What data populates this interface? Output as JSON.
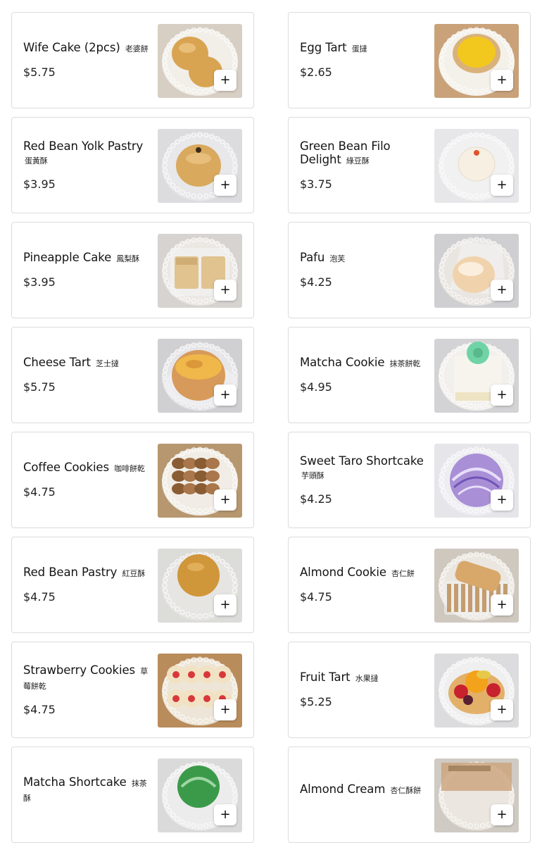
{
  "menu": {
    "add_symbol": "+",
    "items": [
      {
        "name": "Wife Cake (2pcs)",
        "zh": "老婆餅",
        "price": "$5.75",
        "icon": "wife-cake-photo",
        "colors": {
          "bg": "#d8cfc4",
          "plate": "#f2efe9",
          "food": "#d9a451",
          "accent": "#b47c2e"
        }
      },
      {
        "name": "Egg Tart",
        "zh": "蛋撻",
        "price": "$2.65",
        "icon": "egg-tart-photo",
        "colors": {
          "bg": "#c9a27a",
          "plate": "#f4f1ea",
          "food": "#f2c81e",
          "accent": "#d9b27b"
        }
      },
      {
        "name": "Red Bean Yolk Pastry",
        "zh": "蛋黃酥",
        "price": "$3.95",
        "icon": "red-bean-yolk-pastry-photo",
        "colors": {
          "bg": "#dcdcde",
          "plate": "#e8e8ea",
          "food": "#d9a95e",
          "accent": "#3a2a1a"
        }
      },
      {
        "name": "Green Bean Filo Delight",
        "zh": "綠豆酥",
        "price": "$3.75",
        "icon": "green-bean-filo-photo",
        "colors": {
          "bg": "#e7e7e9",
          "plate": "#f1f1f2",
          "food": "#f6efe2",
          "accent": "#e0532a"
        }
      },
      {
        "name": "Pineapple Cake",
        "zh": "鳳梨酥",
        "price": "$3.95",
        "icon": "pineapple-cake-photo",
        "colors": {
          "bg": "#d6d3d0",
          "plate": "#ebe8e4",
          "food": "#e0c38f",
          "accent": "#b98d4a"
        }
      },
      {
        "name": "Pafu",
        "zh": "泡芙",
        "price": "$4.25",
        "icon": "pafu-photo",
        "colors": {
          "bg": "#cfcfd2",
          "plate": "#e9e6e2",
          "food": "#f0d3ac",
          "accent": "#d8a977"
        }
      },
      {
        "name": "Cheese Tart",
        "zh": "芝士撻",
        "price": "$5.75",
        "icon": "cheese-tart-photo",
        "colors": {
          "bg": "#d0d0d2",
          "plate": "#e6e6e8",
          "food": "#f0b74a",
          "accent": "#c67a2a"
        }
      },
      {
        "name": "Matcha Cookie",
        "zh": "抹茶餅乾",
        "price": "$4.95",
        "icon": "matcha-cookie-photo",
        "colors": {
          "bg": "#d3d3d5",
          "plate": "#f2f0ed",
          "food": "#f7f4ee",
          "accent": "#6fd3a6"
        }
      },
      {
        "name": "Coffee Cookies",
        "zh": "咖啡餅乾",
        "price": "$4.75",
        "icon": "coffee-cookies-photo",
        "colors": {
          "bg": "#b7976f",
          "plate": "#f1ede6",
          "food": "#a9774b",
          "accent": "#8a5c34"
        }
      },
      {
        "name": "Sweet Taro Shortcake",
        "zh": "芋頭酥",
        "price": "$4.25",
        "icon": "sweet-taro-shortcake-photo",
        "colors": {
          "bg": "#e6e6ea",
          "plate": "#eeeef2",
          "food": "#a98fd6",
          "accent": "#6f54b8"
        }
      },
      {
        "name": "Red Bean Pastry",
        "zh": "紅豆酥",
        "price": "$4.75",
        "icon": "red-bean-pastry-photo",
        "colors": {
          "bg": "#dcdcd9",
          "plate": "#e6e5e2",
          "food": "#d0963a",
          "accent": "#a96a1e"
        }
      },
      {
        "name": "Almond Cookie",
        "zh": "杏仁餅",
        "price": "$4.75",
        "icon": "almond-cookie-photo",
        "colors": {
          "bg": "#cfc8bf",
          "plate": "#ebe7e0",
          "food": "#d8a86a",
          "accent": "#b07a3a"
        }
      },
      {
        "name": "Strawberry Cookies",
        "zh": "草莓餅乾",
        "price": "$4.75",
        "icon": "strawberry-cookies-photo",
        "colors": {
          "bg": "#b98c5c",
          "plate": "#ede6d8",
          "food": "#f1e2c4",
          "accent": "#d8383a"
        }
      },
      {
        "name": "Fruit Tart",
        "zh": "水果撻",
        "price": "$5.25",
        "icon": "fruit-tart-photo",
        "colors": {
          "bg": "#dcdcde",
          "plate": "#efefef",
          "food": "#f3a21b",
          "accent": "#c8222e"
        }
      },
      {
        "name": "Matcha Shortcake",
        "zh": "抹茶酥",
        "price": "",
        "icon": "matcha-shortcake-photo",
        "colors": {
          "bg": "#d9dad9",
          "plate": "#ececec",
          "food": "#3b9a4a",
          "accent": "#2a7a36"
        }
      },
      {
        "name": "Almond Cream",
        "zh": "杏仁酥餅",
        "price": "",
        "icon": "almond-cream-photo",
        "colors": {
          "bg": "#cfcac3",
          "plate": "#ebe6df",
          "food": "#caa37a",
          "accent": "#8b6a45"
        }
      }
    ]
  }
}
